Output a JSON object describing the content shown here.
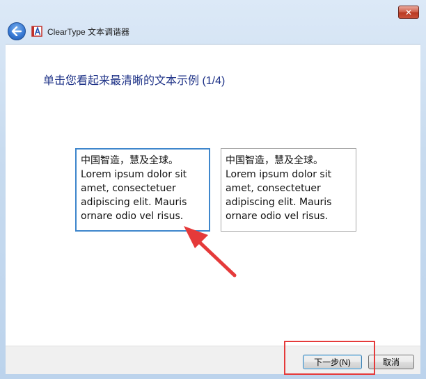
{
  "window": {
    "title": "ClearType 文本调谐器",
    "close_glyph": "✕"
  },
  "instruction": "单击您看起来最清晰的文本示例 (1/4)",
  "samples": [
    {
      "line1": "中国智造，慧及全球。",
      "line2": "Lorem ipsum dolor sit amet, consectetuer adipiscing elit. Mauris ornare odio vel risus."
    },
    {
      "line1": "中国智造，慧及全球。",
      "line2": "Lorem ipsum dolor sit amet, consectetuer adipiscing elit. Mauris ornare odio vel risus."
    }
  ],
  "footer": {
    "next_label": "下一步(N)",
    "cancel_label": "取消"
  },
  "colors": {
    "instruction_text": "#1e3287",
    "selected_border": "#3e86cc",
    "annotation_red": "#e53a3a"
  },
  "icons": {
    "back": "back-arrow-icon",
    "app": "cleartype-icon",
    "close": "close-icon"
  }
}
